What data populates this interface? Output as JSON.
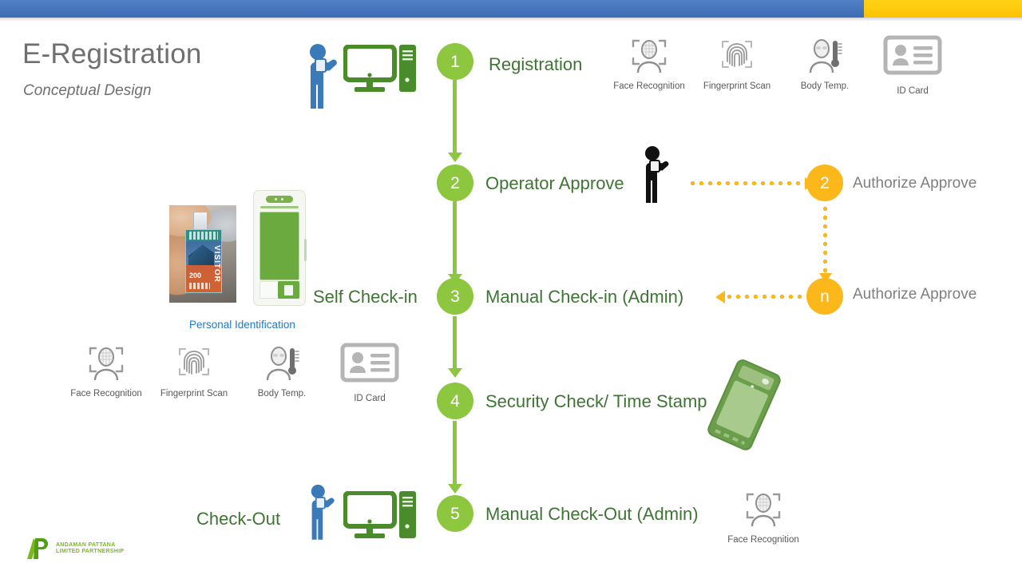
{
  "header": {
    "title": "E-Registration",
    "subtitle": "Conceptual Design",
    "bar_blue": "#3d6cb5",
    "bar_yellow": "#fcc200"
  },
  "colors": {
    "green_node": "#8dc63f",
    "green_text": "#3f7534",
    "orange_node": "#fcb81a",
    "gray_text": "#7f7f7f",
    "blue_caption": "#1f7ac4",
    "blue_person": "#3a7ab8",
    "green_device": "#4a8b2c"
  },
  "flow": {
    "steps": [
      {
        "num": "1",
        "label": "Registration"
      },
      {
        "num": "2",
        "label": "Operator Approve"
      },
      {
        "num": "3",
        "label": "Manual Check-in (Admin)"
      },
      {
        "num": "4",
        "label": "Security Check/ Time Stamp"
      },
      {
        "num": "5",
        "label": "Manual Check-Out (Admin)"
      }
    ]
  },
  "authorize": {
    "nodes": [
      {
        "num": "2",
        "label": "Authorize  Approve"
      },
      {
        "num": "n",
        "label": "Authorize  Approve"
      }
    ]
  },
  "side_labels": {
    "self_checkin": "Self Check-in",
    "check_out": "Check-Out",
    "personal_identification": "Personal Identification"
  },
  "biometrics_top": [
    {
      "icon": "face-recognition-icon",
      "label": "Face Recognition"
    },
    {
      "icon": "fingerprint-scan-icon",
      "label": "Fingerprint Scan"
    },
    {
      "icon": "body-temp-icon",
      "label": "Body Temp."
    },
    {
      "icon": "id-card-icon",
      "label": "ID Card"
    }
  ],
  "biometrics_bottom": [
    {
      "icon": "face-recognition-icon",
      "label": "Face Recognition"
    },
    {
      "icon": "fingerprint-scan-icon",
      "label": "Fingerprint Scan"
    },
    {
      "icon": "body-temp-icon",
      "label": "Body Temp."
    },
    {
      "icon": "id-card-icon",
      "label": "ID Card"
    }
  ],
  "biometrics_checkout": [
    {
      "icon": "face-recognition-icon",
      "label": "Face Recognition"
    }
  ],
  "badge": {
    "visitor_text": "VISITOR",
    "number": "200"
  },
  "logo": {
    "line1": "ANDAMAN PATTANA",
    "line2": "LIMITED PARTNERSHIP"
  }
}
